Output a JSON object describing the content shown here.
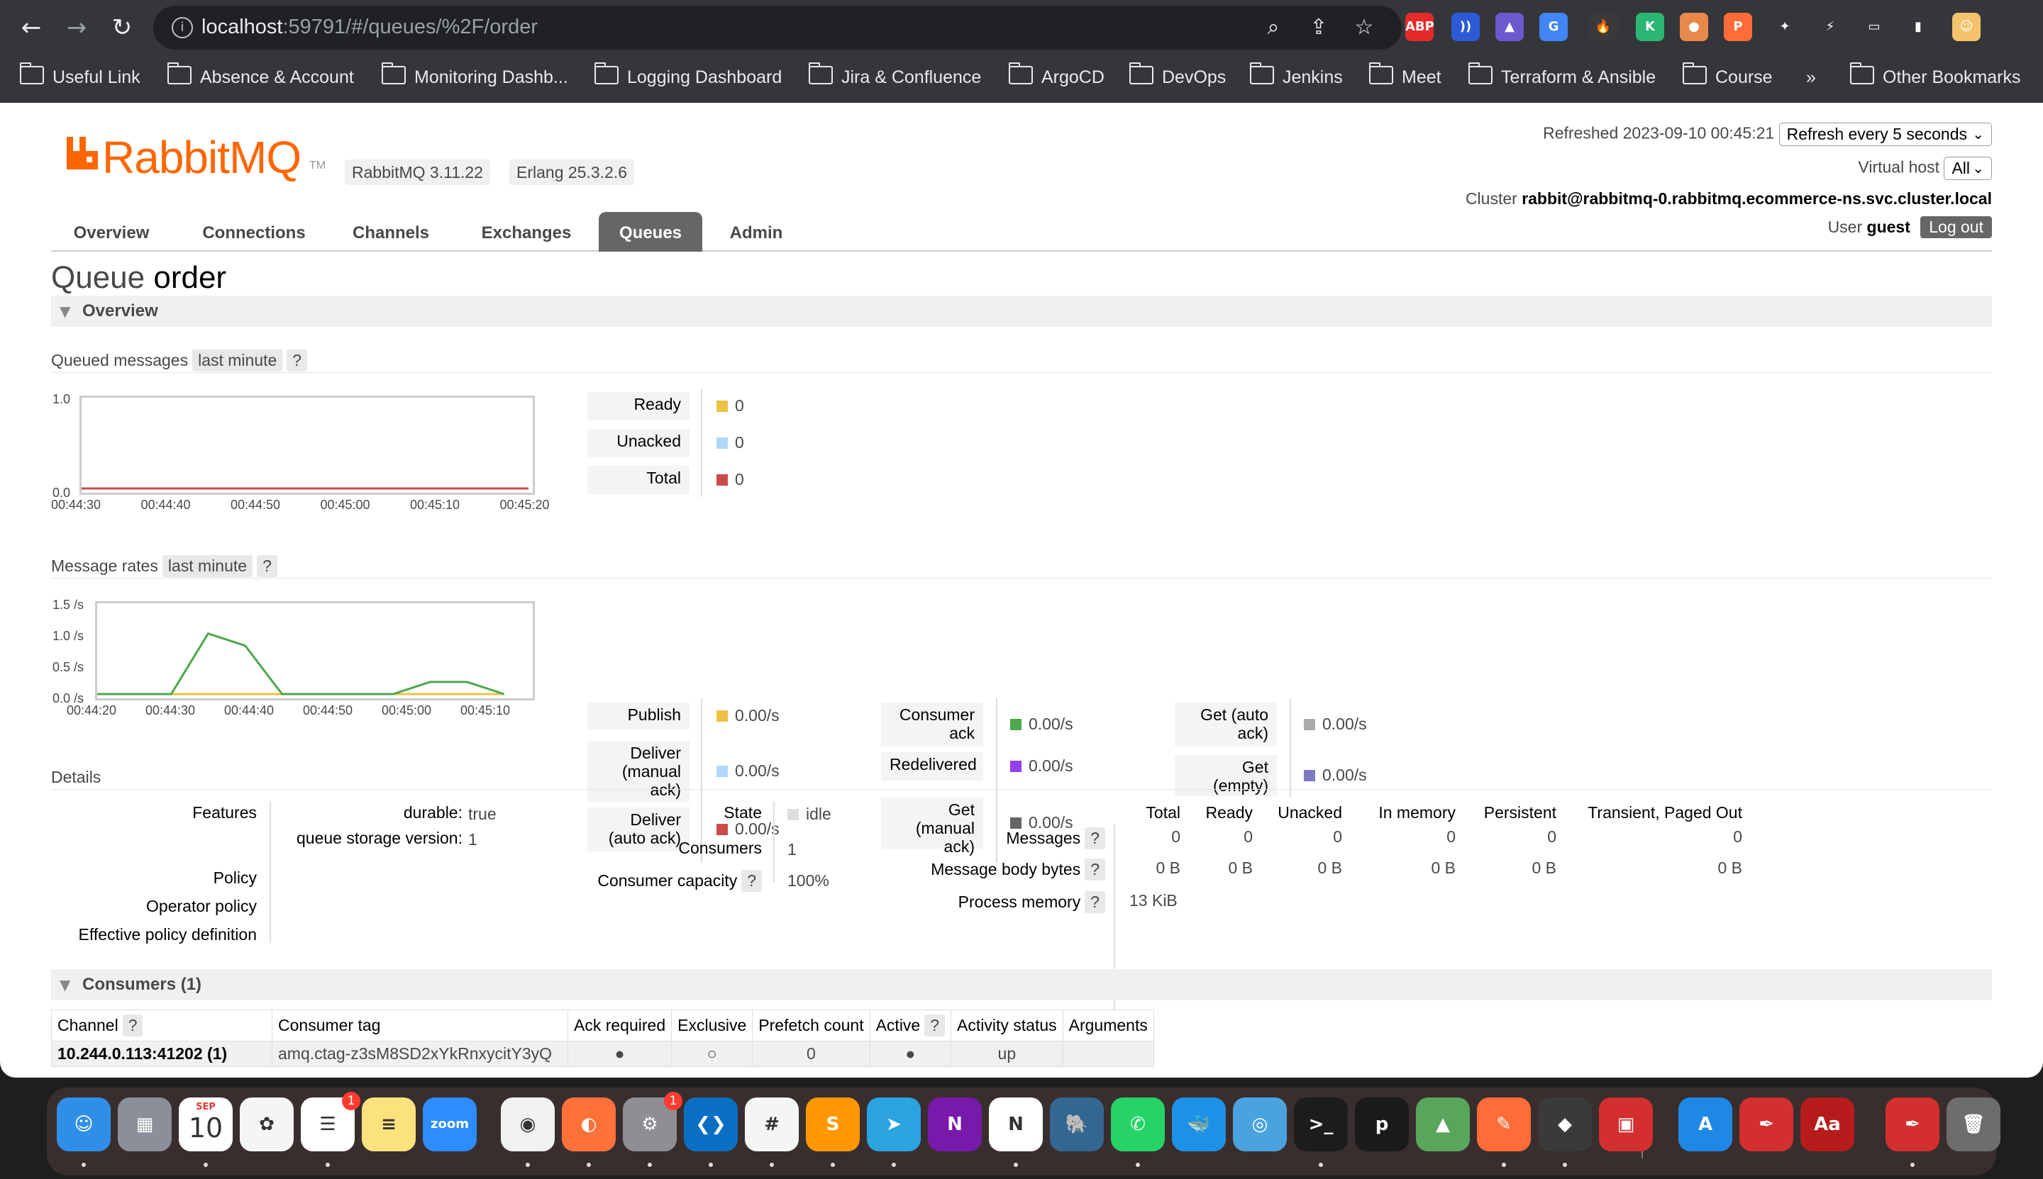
{
  "browser": {
    "url_host": "localhost",
    "url_rest": ":59791/#/queues/%2F/order",
    "bookmarks": [
      "Useful Link",
      "Absence & Account",
      "Monitoring Dashb...",
      "Logging Dashboard",
      "Jira & Confluence",
      "ArgoCD",
      "DevOps",
      "Jenkins",
      "Meet",
      "Terraform & Ansible",
      "Course"
    ],
    "more": "»",
    "other_bookmarks": "Other Bookmarks",
    "extensions": [
      {
        "name": "adblock-plus-icon",
        "label": "ABP",
        "color": "#e52a2a"
      },
      {
        "name": "wave-extension-icon",
        "label": "))",
        "color": "#2d5bd6"
      },
      {
        "name": "mountain-extension-icon",
        "label": "▲",
        "color": "#6a5acd"
      },
      {
        "name": "translate-extension-icon",
        "label": "G",
        "color": "#4285f4"
      },
      {
        "name": "fire-extension-icon",
        "label": "🔥",
        "color": "#3a3a3a"
      },
      {
        "name": "kiwi-extension-icon",
        "label": "K",
        "color": "#2bb673"
      },
      {
        "name": "bottle-extension-icon",
        "label": "●",
        "color": "#e8894a"
      },
      {
        "name": "postman-extension-icon",
        "label": "P",
        "color": "#ff6c37"
      },
      {
        "name": "puzzle-extensions-icon",
        "label": "✦",
        "color": "#35363a"
      },
      {
        "name": "speed-extension-icon",
        "label": "⚡",
        "color": "#35363a"
      },
      {
        "name": "cast-icon",
        "label": "▭",
        "color": "#35363a"
      },
      {
        "name": "sidepanel-icon",
        "label": "▮",
        "color": "#35363a"
      },
      {
        "name": "profile-avatar-icon",
        "label": "☺",
        "color": "#f3c26b"
      }
    ]
  },
  "header": {
    "logo_rabbit": "Rabbit",
    "logo_mq": "MQ",
    "logo_tm": "TM",
    "rabbitmq_version": "RabbitMQ 3.11.22",
    "erlang_version": "Erlang 25.3.2.6",
    "refreshed_label": "Refreshed 2023-09-10 00:45:21",
    "refresh_option": "Refresh every 5 seconds",
    "vhost_label": "Virtual host",
    "vhost_option": "All",
    "cluster_label": "Cluster",
    "cluster_name": "rabbit@rabbitmq-0.rabbitmq.ecommerce-ns.svc.cluster.local",
    "user_label": "User",
    "user_name": "guest",
    "logout": "Log out"
  },
  "tabs": [
    "Overview",
    "Connections",
    "Channels",
    "Exchanges",
    "Queues",
    "Admin"
  ],
  "title": {
    "prefix": "Queue",
    "name": "order"
  },
  "overview": {
    "section_label": "Overview",
    "queued_label": "Queued messages",
    "queued_range": "last minute",
    "rates_label": "Message rates",
    "rates_range": "last minute",
    "help": "?"
  },
  "queued_chart": {
    "y_ticks": [
      "1.0",
      "0.0"
    ],
    "x_ticks": [
      "00:44:30",
      "00:44:40",
      "00:44:50",
      "00:45:00",
      "00:45:10",
      "00:45:20"
    ],
    "legend": [
      {
        "label": "Ready",
        "value": "0",
        "color": "#edc240"
      },
      {
        "label": "Unacked",
        "value": "0",
        "color": "#afd8f8"
      },
      {
        "label": "Total",
        "value": "0",
        "color": "#cb4b4b"
      }
    ]
  },
  "rates_chart": {
    "y_ticks": [
      "1.5 /s",
      "1.0 /s",
      "0.5 /s",
      "0.0 /s"
    ],
    "x_ticks": [
      "00:44:20",
      "00:44:30",
      "00:44:40",
      "00:44:50",
      "00:45:00",
      "00:45:10"
    ],
    "legend_col1": [
      {
        "label": "Publish",
        "value": "0.00/s",
        "color": "#edc240"
      },
      {
        "label": "Deliver\n(manual\nack)",
        "value": "0.00/s",
        "color": "#afd8f8"
      },
      {
        "label": "Deliver\n(auto ack)",
        "value": "0.00/s",
        "color": "#cb4b4b"
      }
    ],
    "legend_col2": [
      {
        "label": "Consumer\nack",
        "value": "0.00/s",
        "color": "#4da74d"
      },
      {
        "label": "Redelivered",
        "value": "0.00/s",
        "color": "#9440ed"
      },
      {
        "label": "Get\n(manual\nack)",
        "value": "0.00/s",
        "color": "#666666"
      }
    ],
    "legend_col3": [
      {
        "label": "Get (auto\nack)",
        "value": "0.00/s",
        "color": "#aaaaaa"
      },
      {
        "label": "Get\n(empty)",
        "value": "0.00/s",
        "color": "#7c79c3"
      }
    ]
  },
  "chart_data": [
    {
      "type": "line",
      "title": "Queued messages",
      "x": [
        "00:44:30",
        "00:44:40",
        "00:44:50",
        "00:45:00",
        "00:45:10",
        "00:45:20"
      ],
      "ylim": [
        0,
        1.0
      ],
      "series": [
        {
          "name": "Ready",
          "values": [
            0,
            0,
            0,
            0,
            0,
            0
          ]
        },
        {
          "name": "Unacked",
          "values": [
            0,
            0,
            0,
            0,
            0,
            0
          ]
        },
        {
          "name": "Total",
          "values": [
            0,
            0,
            0,
            0,
            0,
            0
          ]
        }
      ]
    },
    {
      "type": "line",
      "title": "Message rates",
      "x": [
        "00:44:20",
        "00:44:25",
        "00:44:30",
        "00:44:35",
        "00:44:40",
        "00:44:45",
        "00:44:50",
        "00:44:55",
        "00:45:00",
        "00:45:05",
        "00:45:10",
        "00:45:15"
      ],
      "ylim": [
        0,
        1.5
      ],
      "series": [
        {
          "name": "Consumer ack",
          "values": [
            0,
            0,
            0,
            1.0,
            0.8,
            0,
            0,
            0,
            0,
            0.2,
            0.2,
            0
          ]
        },
        {
          "name": "Publish",
          "values": [
            0,
            0,
            0,
            0,
            0,
            0,
            0,
            0,
            0,
            0,
            0,
            0
          ]
        },
        {
          "name": "Deliver (auto ack)",
          "values": [
            0,
            0,
            0,
            0,
            0,
            0,
            0,
            0,
            0,
            0,
            0,
            0
          ]
        }
      ]
    }
  ],
  "details": {
    "section_label": "Details",
    "features_label": "Features",
    "durable_key": "durable:",
    "durable_val": "true",
    "qsv_key": "queue storage version:",
    "qsv_val": "1",
    "policy_label": "Policy",
    "operator_policy_label": "Operator policy",
    "effective_policy_label": "Effective policy definition",
    "state_label": "State",
    "state_val": "idle",
    "consumers_label": "Consumers",
    "consumers_val": "1",
    "capacity_label": "Consumer capacity",
    "capacity_val": "100%",
    "stats_cols": [
      "Total",
      "Ready",
      "Unacked",
      "In memory",
      "Persistent",
      "Transient, Paged Out"
    ],
    "messages_label": "Messages",
    "messages_vals": [
      "0",
      "0",
      "0",
      "0",
      "0",
      "0"
    ],
    "body_bytes_label": "Message body bytes",
    "body_bytes_vals": [
      "0 B",
      "0 B",
      "0 B",
      "0 B",
      "0 B",
      "0 B"
    ],
    "process_memory_label": "Process memory",
    "process_memory_val": "13 KiB"
  },
  "consumers": {
    "section_label": "Consumers (1)",
    "columns": [
      "Channel",
      "Consumer tag",
      "Ack required",
      "Exclusive",
      "Prefetch count",
      "Active",
      "Activity status",
      "Arguments"
    ],
    "rows": [
      {
        "channel": "10.244.0.113:41202 (1)",
        "tag": "amq.ctag-z3sM8SD2xYkRnxycitY3yQ",
        "ack": "●",
        "exclusive": "○",
        "prefetch": "0",
        "active": "●",
        "status": "up",
        "arguments": ""
      }
    ]
  },
  "dock": [
    {
      "name": "finder-icon",
      "label": "☺",
      "color": "#2f8fe8"
    },
    {
      "name": "launchpad-icon",
      "label": "▦",
      "color": "#8a8f9a"
    },
    {
      "name": "calendar-icon",
      "label": "10",
      "color": "#ffffff",
      "sub": "SEP"
    },
    {
      "name": "photos-icon",
      "label": "✿",
      "color": "#f5f5f5"
    },
    {
      "name": "reminders-icon",
      "label": "☰",
      "color": "#ffffff",
      "badge": "1"
    },
    {
      "name": "notes-icon",
      "label": "≡",
      "color": "#fbe27d"
    },
    {
      "name": "zoom-icon",
      "label": "zoom",
      "color": "#2d8cff"
    },
    {
      "name": "chrome-icon",
      "label": "◉",
      "color": "#f1f1f1"
    },
    {
      "name": "firefox-icon",
      "label": "◐",
      "color": "#ff7139"
    },
    {
      "name": "system-settings-icon",
      "label": "⚙",
      "color": "#8e8e93",
      "badge": "1"
    },
    {
      "name": "vscode-icon",
      "label": "❮❯",
      "color": "#0a6fc2"
    },
    {
      "name": "slack-icon",
      "label": "#",
      "color": "#f5f5f5"
    },
    {
      "name": "sublime-text-icon",
      "label": "S",
      "color": "#ff9800"
    },
    {
      "name": "telegram-icon",
      "label": "➤",
      "color": "#2aa3e0"
    },
    {
      "name": "onenote-icon",
      "label": "N",
      "color": "#7719aa"
    },
    {
      "name": "notion-icon",
      "label": "N",
      "color": "#ffffff"
    },
    {
      "name": "pgadmin-icon",
      "label": "🐘",
      "color": "#336791"
    },
    {
      "name": "whatsapp-icon",
      "label": "✆",
      "color": "#25d366"
    },
    {
      "name": "docker-icon",
      "label": "🐳",
      "color": "#1d91e6"
    },
    {
      "name": "screenshot-icon",
      "label": "◎",
      "color": "#4aa3df"
    },
    {
      "name": "terminal-icon",
      "label": ">_",
      "color": "#1c1c1c"
    },
    {
      "name": "pricetag-icon",
      "label": "p",
      "color": "#1a1a1a"
    },
    {
      "name": "rocket-icon",
      "label": "▲",
      "color": "#58a55c"
    },
    {
      "name": "postman-dock-icon",
      "label": "✎",
      "color": "#ff6c37"
    },
    {
      "name": "tableplus-icon",
      "label": "◆",
      "color": "#3a3a3a"
    },
    {
      "name": "boxes-icon",
      "label": "▣",
      "color": "#d32f2f"
    },
    {
      "name": "app-store-icon",
      "label": "A",
      "color": "#1e88e5"
    },
    {
      "name": "acrobat-icon",
      "label": "✒",
      "color": "#d32f2f"
    },
    {
      "name": "dictionary-icon",
      "label": "Aa",
      "color": "#b71c1c"
    },
    {
      "name": "acrobat-recent-icon",
      "label": "✒",
      "color": "#d32f2f"
    },
    {
      "name": "trash-icon",
      "label": "🗑",
      "color": "#6d6d6d"
    }
  ]
}
